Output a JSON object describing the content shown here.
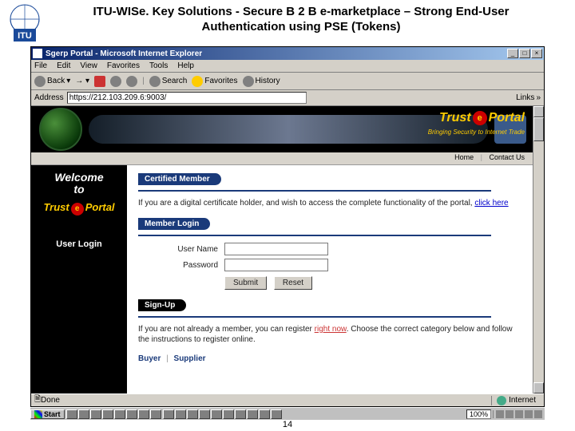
{
  "slide": {
    "title": "ITU-WISe. Key Solutions - Secure B 2 B e-marketplace – Strong End-User Authentication using PSE (Tokens)",
    "page_number": "14"
  },
  "browser": {
    "window_title": "Sgerp Portal - Microsoft Internet Explorer",
    "menu": {
      "file": "File",
      "edit": "Edit",
      "view": "View",
      "favorites": "Favorites",
      "tools": "Tools",
      "help": "Help"
    },
    "toolbar": {
      "back": "Back",
      "search": "Search",
      "favorites": "Favorites",
      "history": "History"
    },
    "address_label": "Address",
    "address_value": "https://212.103.209.6:9003/",
    "links_label": "Links",
    "status": {
      "done": "Done",
      "zone": "Internet",
      "zoom": "100%"
    }
  },
  "portal": {
    "brand": {
      "trust": "Trust",
      "portal": "Portal",
      "tagline": "Bringing Security to Internet Trade"
    },
    "subnav": {
      "home": "Home",
      "contact": "Contact Us"
    },
    "sidebar": {
      "welcome_l1": "Welcome",
      "welcome_l2": "to",
      "trust": "Trust",
      "portal": "Portal",
      "user_login": "User Login"
    },
    "sections": {
      "certified": {
        "title": "Certified Member",
        "desc_prefix": "If you are a digital certificate holder, and wish to access the complete functionality of the portal, ",
        "link": "click here"
      },
      "login": {
        "title": "Member Login",
        "username_label": "User Name",
        "password_label": "Password",
        "submit": "Submit",
        "reset": "Reset"
      },
      "signup": {
        "title": "Sign-Up",
        "desc_prefix": "If you are not already a member, you can register ",
        "link": "right now",
        "desc_suffix": ". Choose the correct category below and follow the instructions to register online.",
        "buyer": "Buyer",
        "supplier": "Supplier"
      }
    }
  },
  "taskbar": {
    "start": "Start"
  }
}
